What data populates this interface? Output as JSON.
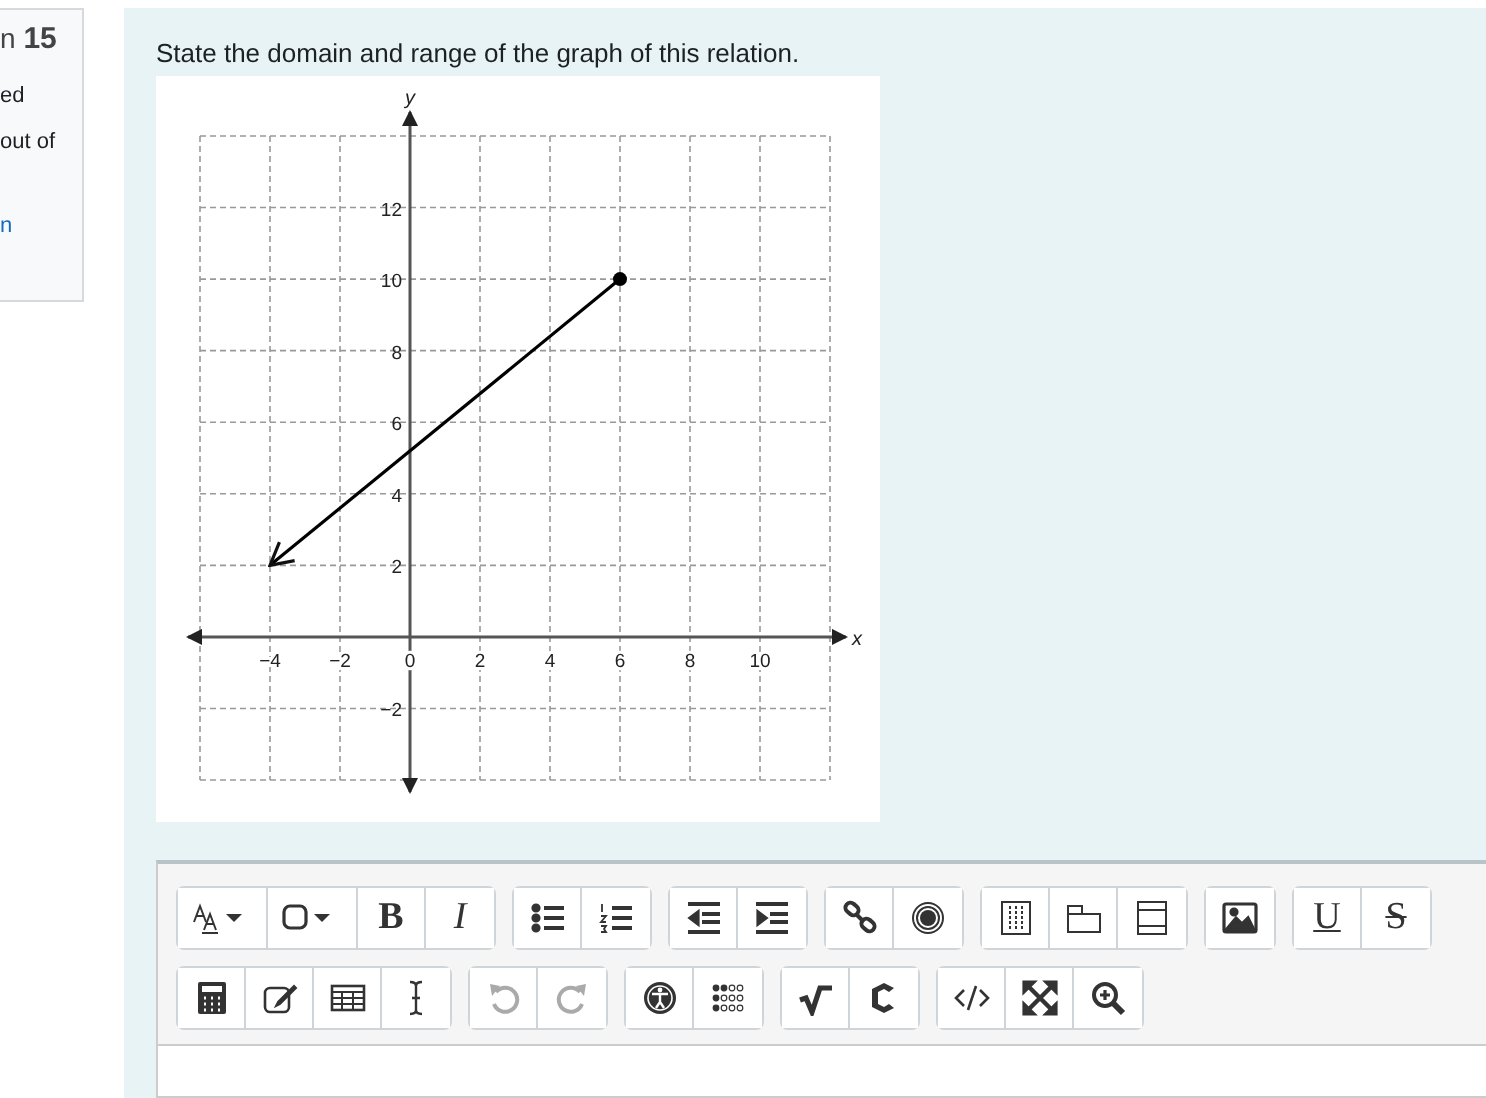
{
  "sidebar": {
    "title": "n **15**",
    "lines": [
      "ed",
      "out of"
    ],
    "link": "n"
  },
  "question": {
    "text": "State the domain and range of the graph of this relation.",
    "chart_data": {
      "type": "line",
      "xlabel": "x",
      "ylabel": "y",
      "x": [
        6,
        -4
      ],
      "series": [
        {
          "color": "#000000",
          "values": [
            10,
            2
          ]
        }
      ],
      "grid": true,
      "xlim": [
        -6,
        12
      ],
      "ylim": [
        -4,
        14
      ],
      "xticks": [
        -4,
        -2,
        0,
        2,
        4,
        6,
        8,
        10
      ],
      "yticks": [
        -2,
        2,
        4,
        6,
        8,
        10,
        12
      ]
    }
  },
  "toolbar_rows": [
    [
      [
        {
          "kind": "font-color",
          "disabled": false
        },
        {
          "kind": "shape",
          "disabled": false
        },
        {
          "kind": "bold",
          "label": "B",
          "disabled": false
        },
        {
          "kind": "italic",
          "label": "I",
          "disabled": false
        }
      ],
      [
        {
          "kind": "bullets",
          "disabled": false
        },
        {
          "kind": "numbers",
          "disabled": false
        }
      ],
      [
        {
          "kind": "outdent",
          "disabled": false
        },
        {
          "kind": "indent",
          "disabled": false
        }
      ],
      [
        {
          "kind": "link",
          "disabled": false
        },
        {
          "kind": "record",
          "disabled": false
        }
      ],
      [
        {
          "kind": "grid",
          "disabled": false
        },
        {
          "kind": "tabs",
          "disabled": false
        },
        {
          "kind": "panel",
          "disabled": false
        }
      ],
      [
        {
          "kind": "image",
          "disabled": false
        }
      ],
      [
        {
          "kind": "underline",
          "label": "U",
          "disabled": false
        },
        {
          "kind": "strike",
          "label": "S",
          "disabled": false
        }
      ]
    ],
    [
      [
        {
          "kind": "calculator",
          "disabled": false
        },
        {
          "kind": "edit",
          "disabled": false
        },
        {
          "kind": "table",
          "disabled": false
        },
        {
          "kind": "cursor",
          "disabled": false
        }
      ],
      [
        {
          "kind": "undo",
          "disabled": true
        },
        {
          "kind": "redo",
          "disabled": true
        }
      ],
      [
        {
          "kind": "accessibility",
          "disabled": false
        },
        {
          "kind": "braille",
          "disabled": false
        }
      ],
      [
        {
          "kind": "sqrt",
          "disabled": false
        },
        {
          "kind": "chem",
          "disabled": false
        }
      ],
      [
        {
          "kind": "code",
          "disabled": false
        },
        {
          "kind": "fullscreen",
          "disabled": false
        },
        {
          "kind": "zoom",
          "disabled": false
        }
      ]
    ]
  ]
}
